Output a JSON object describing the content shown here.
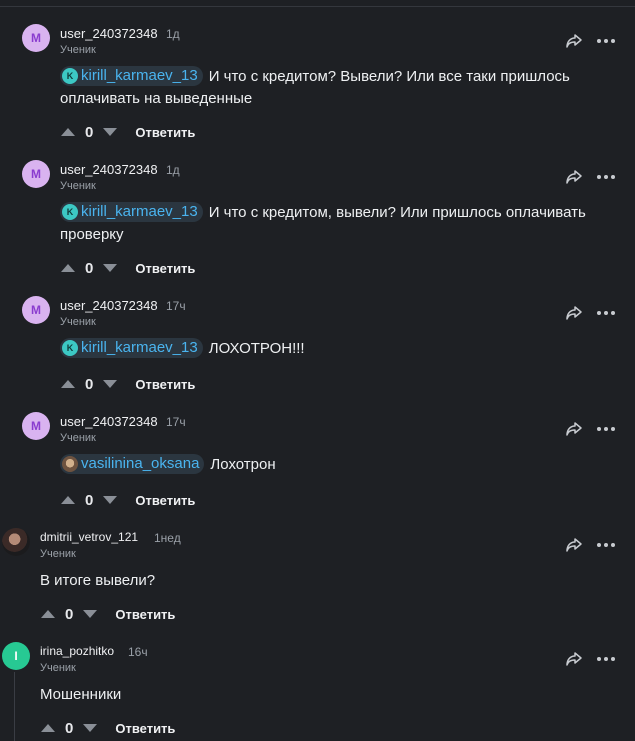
{
  "comments": [
    {
      "avatar_letter": "M",
      "username": "user_240372348",
      "time": "1д",
      "rank": "Ученик",
      "mention": {
        "initial": "K",
        "name": "kirill_karmaev_13"
      },
      "text_line1": "И что с кредитом? Вывели? Или все таки пришлось",
      "text_line2": "оплачивать на выведенные",
      "votes": "0",
      "reply_label": "Ответить"
    },
    {
      "avatar_letter": "M",
      "username": "user_240372348",
      "time": "1д",
      "rank": "Ученик",
      "mention": {
        "initial": "K",
        "name": "kirill_karmaev_13"
      },
      "text_line1": "И что с кредитом, вывели? Или пришлось оплачивать",
      "text_line2": "проверку",
      "votes": "0",
      "reply_label": "Ответить"
    },
    {
      "avatar_letter": "M",
      "username": "user_240372348",
      "time": "17ч",
      "rank": "Ученик",
      "mention": {
        "initial": "K",
        "name": "kirill_karmaev_13"
      },
      "text_line1": "ЛОХОТРОН!!!",
      "votes": "0",
      "reply_label": "Ответить"
    },
    {
      "avatar_letter": "M",
      "username": "user_240372348",
      "time": "17ч",
      "rank": "Ученик",
      "mention": {
        "name": "vasilinina_oksana"
      },
      "text_line1": "Лохотрон",
      "votes": "0",
      "reply_label": "Ответить"
    },
    {
      "username": "dmitrii_vetrov_121",
      "time": "1нед",
      "rank": "Ученик",
      "text_line1": "В итоге вывели?",
      "votes": "0",
      "reply_label": "Ответить"
    },
    {
      "avatar_letter": "I",
      "username": "irina_pozhitko",
      "time": "16ч",
      "rank": "Ученик",
      "text_line1": "Мошенники",
      "votes": "0",
      "reply_label": "Ответить"
    }
  ],
  "icons": {
    "share": "share-arrow-icon",
    "more": "more-dots-icon",
    "upvote": "upvote-arrow-icon",
    "downvote": "downvote-arrow-icon"
  },
  "colors": {
    "background": "#1e2024",
    "mention_text": "#4ab4ef",
    "avatar_m_bg": "#d9b3f0",
    "avatar_i_bg": "#27c993"
  }
}
